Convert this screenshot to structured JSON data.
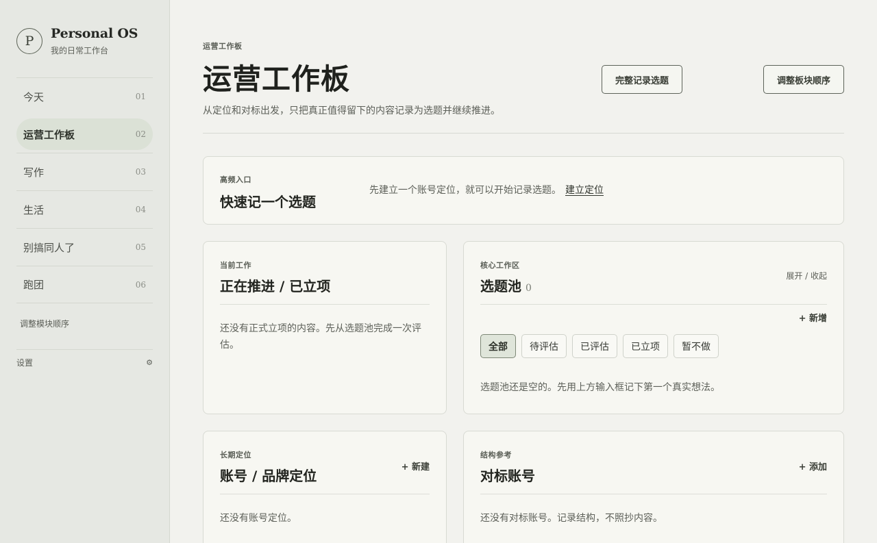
{
  "brand": {
    "logo_letter": "P",
    "name": "Personal OS",
    "subtitle": "我的日常工作台"
  },
  "nav": [
    {
      "label": "今天",
      "num": "01"
    },
    {
      "label": "运营工作板",
      "num": "02",
      "active": true
    },
    {
      "label": "写作",
      "num": "03"
    },
    {
      "label": "生活",
      "num": "04"
    },
    {
      "label": "别搞同人了",
      "num": "05"
    },
    {
      "label": "跑团",
      "num": "06"
    }
  ],
  "sidebar": {
    "reorder_label": "调整模块顺序",
    "settings_label": "设置",
    "settings_icon": "gear-icon"
  },
  "header": {
    "eyebrow": "运营工作板",
    "title": "运营工作板",
    "description": "从定位和对标出发，只把真正值得留下的内容记录为选题并继续推进。",
    "record_button": "完整记录选题",
    "order_button": "调整板块顺序"
  },
  "quick": {
    "eyebrow": "高频入口",
    "title": "快速记一个选题",
    "message": "先建立一个账号定位，就可以开始记录选题。",
    "link": "建立定位"
  },
  "current": {
    "eyebrow": "当前工作",
    "title": "正在推进 / 已立项",
    "empty": "还没有正式立项的内容。先从选题池完成一次评估。"
  },
  "pool": {
    "eyebrow": "核心工作区",
    "title": "选题池",
    "count": "0",
    "toggle": "展开 / 收起",
    "add": "+ 新增",
    "filters": [
      "全部",
      "待评估",
      "已评估",
      "已立项",
      "暂不做"
    ],
    "empty": "选题池还是空的。先用上方输入框记下第一个真实想法。"
  },
  "account": {
    "eyebrow": "长期定位",
    "title": "账号 / 品牌定位",
    "add": "+ 新建",
    "empty": "还没有账号定位。"
  },
  "bench": {
    "eyebrow": "结构参考",
    "title": "对标账号",
    "add": "+ 添加",
    "empty": "还没有对标账号。记录结构，不照抄内容。"
  }
}
